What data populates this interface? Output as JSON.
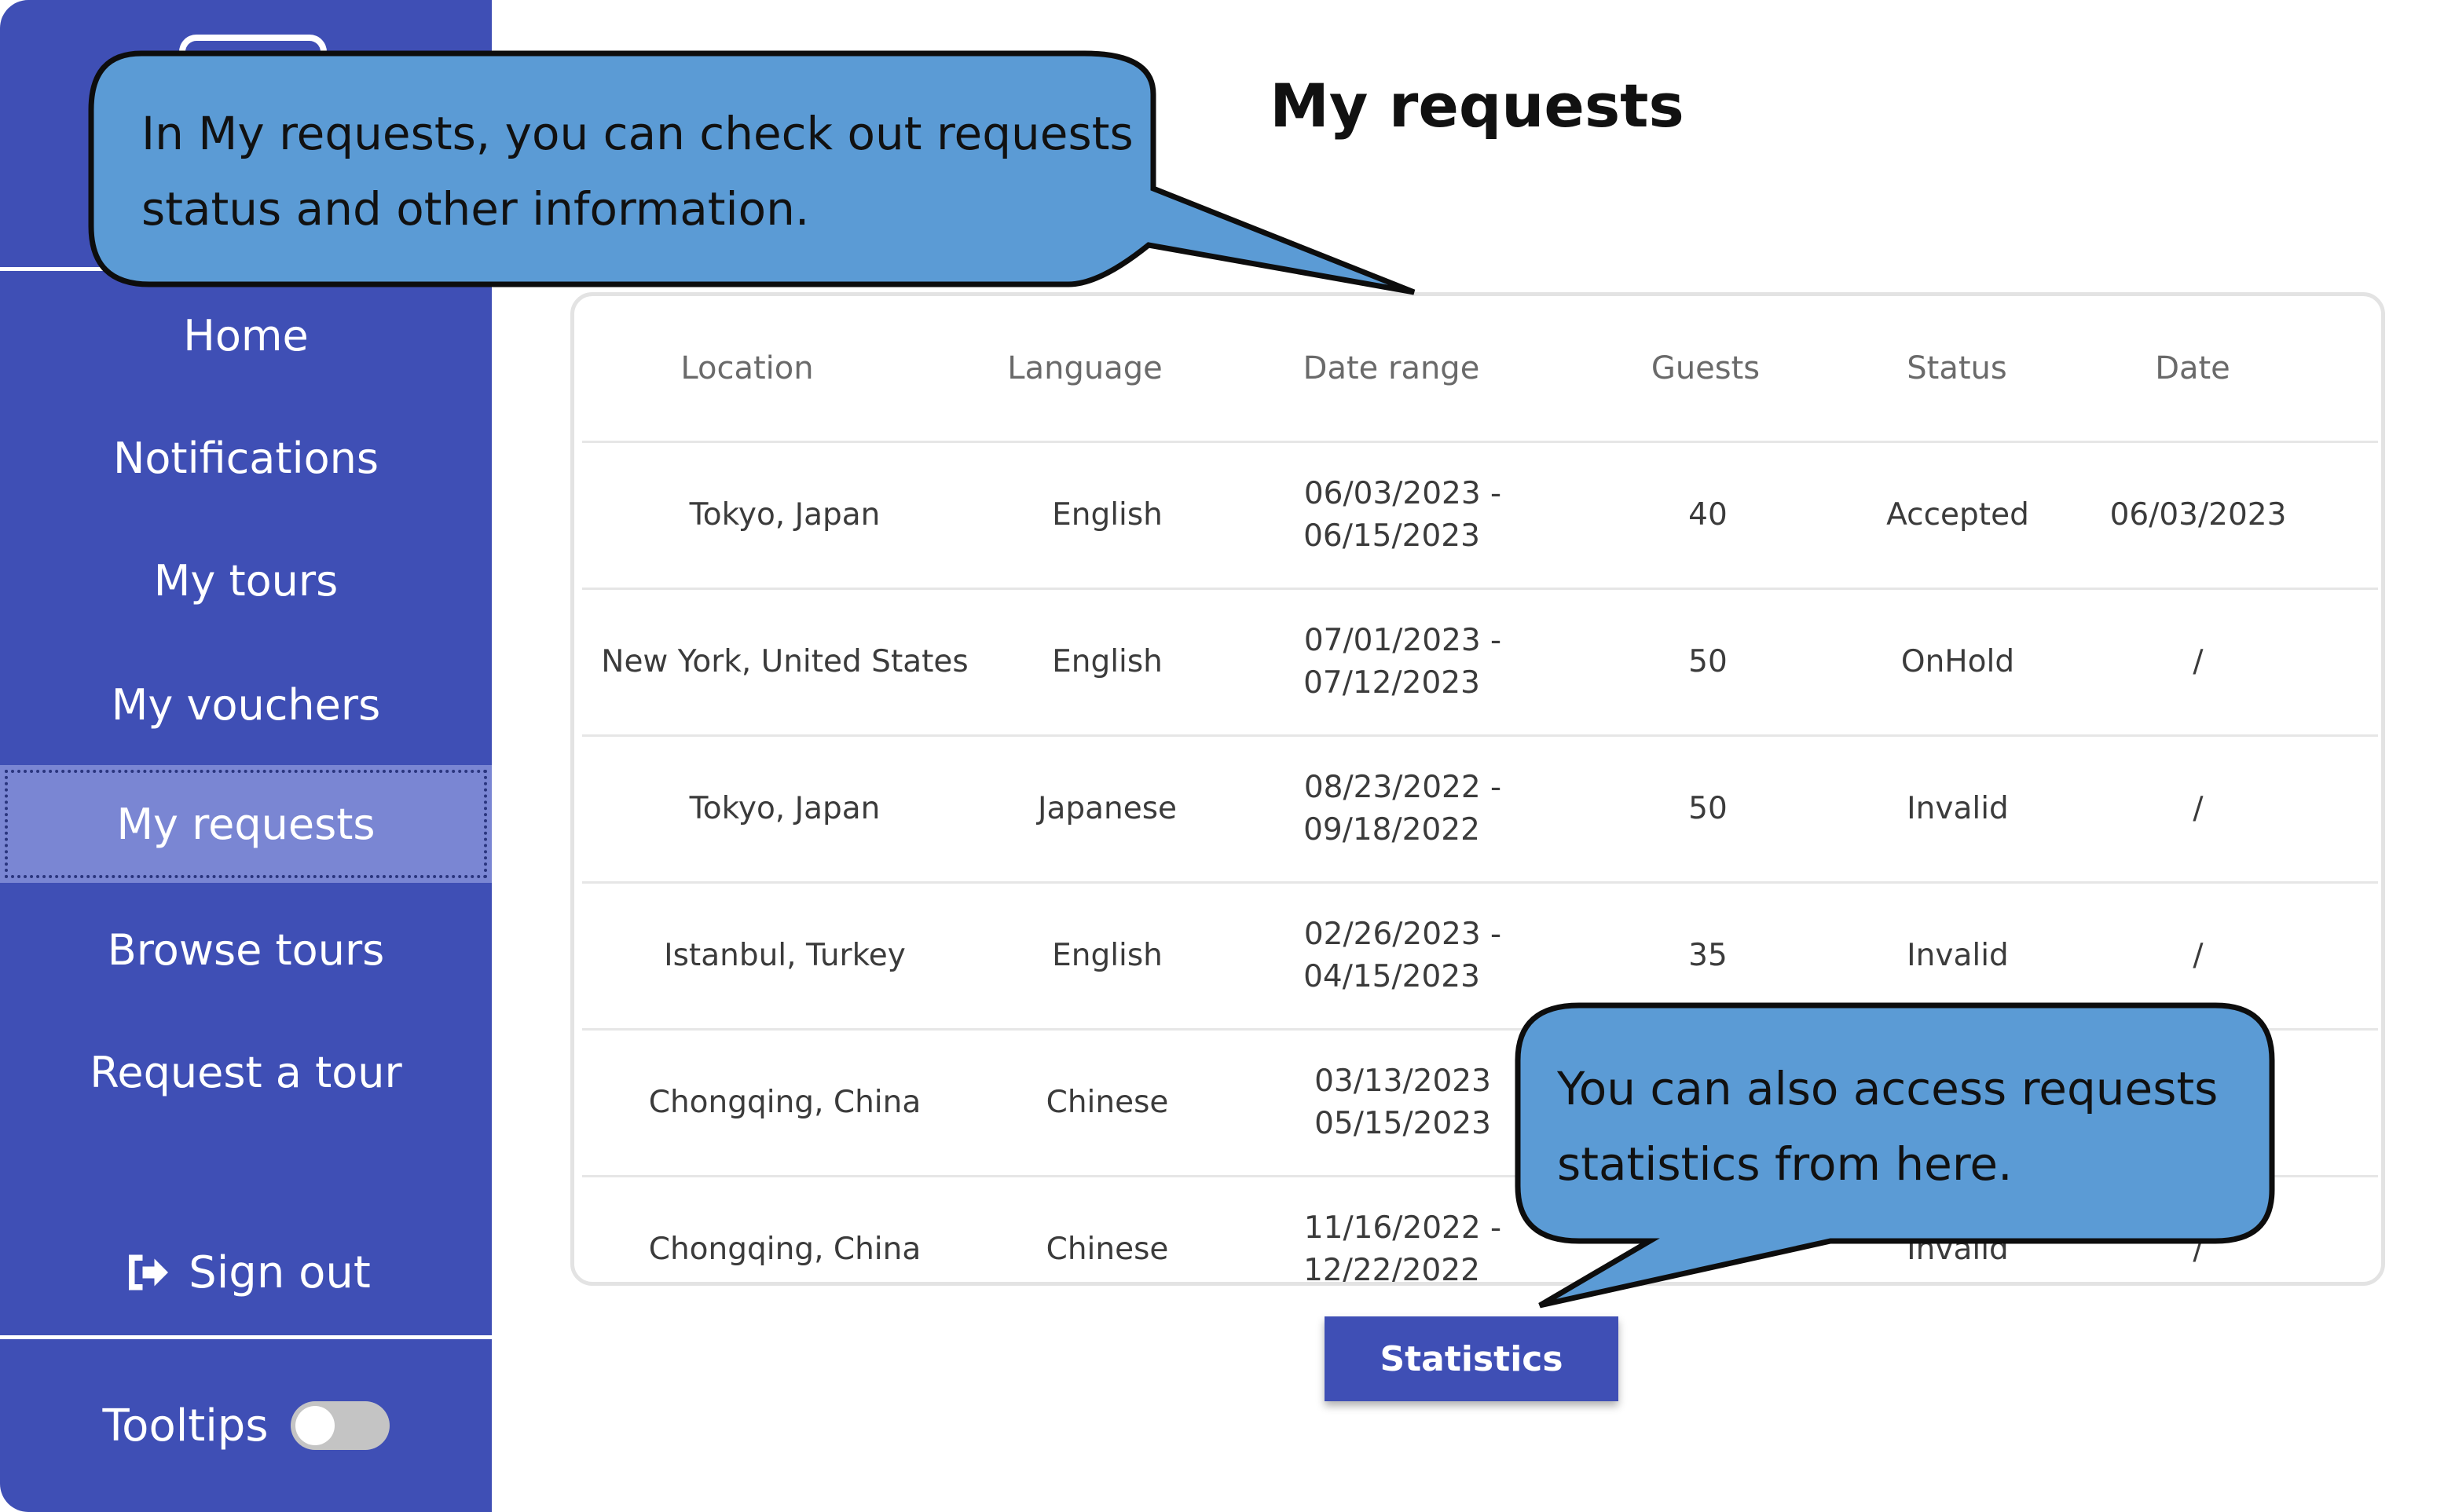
{
  "sidebar": {
    "items": [
      {
        "label": "Home"
      },
      {
        "label": "Notifications"
      },
      {
        "label": "My tours"
      },
      {
        "label": "My vouchers"
      },
      {
        "label": "My requests",
        "active": true
      },
      {
        "label": "Browse tours"
      },
      {
        "label": "Request a tour"
      }
    ],
    "sign_out": {
      "label": "Sign out",
      "icon": "sign-out-icon"
    },
    "tooltips": {
      "label": "Tooltips",
      "enabled": false
    }
  },
  "main": {
    "title": "My requests",
    "table": {
      "columns": [
        "Location",
        "Language",
        "Date range",
        "Guests",
        "Status",
        "Date"
      ],
      "rows": [
        {
          "location": "Tokyo, Japan",
          "language": "English",
          "range_start": "06/03/2023 -",
          "range_end": "06/15/2023",
          "guests": "40",
          "status": "Accepted",
          "date": "06/03/2023"
        },
        {
          "location": "New York, United States",
          "language": "English",
          "range_start": "07/01/2023 -",
          "range_end": "07/12/2023",
          "guests": "50",
          "status": "OnHold",
          "date": "/"
        },
        {
          "location": "Tokyo, Japan",
          "language": "Japanese",
          "range_start": "08/23/2022 -",
          "range_end": "09/18/2022",
          "guests": "50",
          "status": "Invalid",
          "date": "/"
        },
        {
          "location": "Istanbul, Turkey",
          "language": "English",
          "range_start": "02/26/2023 -",
          "range_end": "04/15/2023",
          "guests": "35",
          "status": "Invalid",
          "date": "/"
        },
        {
          "location": "Chongqing, China",
          "language": "Chinese",
          "range_start": "03/13/2023",
          "range_end": "05/15/2023",
          "guests": "",
          "status": "",
          "date": ""
        },
        {
          "location": "Chongqing, China",
          "language": "Chinese",
          "range_start": "11/16/2022 -",
          "range_end": "12/22/2022",
          "guests": "",
          "status": "Invalid",
          "date": "/"
        }
      ]
    },
    "statistics_button": "Statistics"
  },
  "tooltips_overlay": {
    "top": {
      "line1": "In My requests, you can check out requests",
      "line2": "status and other information."
    },
    "bottom": {
      "line1": "You can also access requests",
      "line2": "statistics from here."
    }
  },
  "colors": {
    "sidebar": "#3f4fb5",
    "sidebar_active": "#7a86d3",
    "callout_fill": "#5b9bd5",
    "button": "#3f4fb5"
  }
}
